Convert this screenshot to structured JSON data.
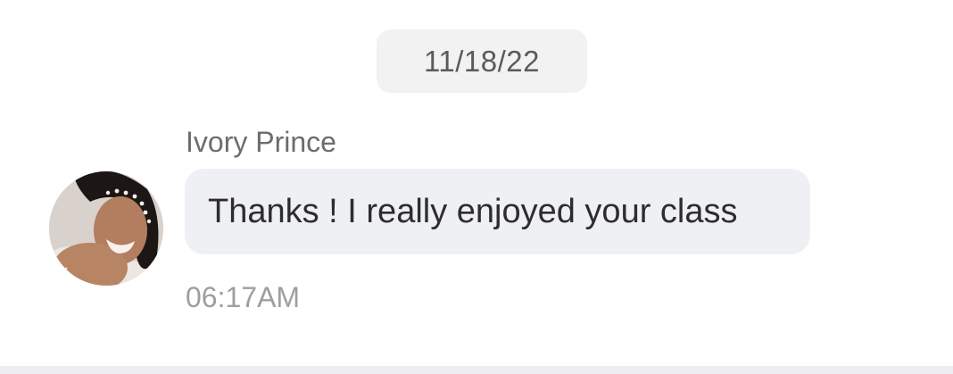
{
  "chat": {
    "date_separator": "11/18/22",
    "message": {
      "sender_name": "Ivory Prince",
      "avatar": "user-photo",
      "text": "Thanks ! I really enjoyed your class",
      "time": "06:17AM"
    }
  },
  "colors": {
    "background": "#ffffff",
    "date_chip_bg": "#f2f2f3",
    "bubble_bg": "#eff0f4",
    "sender_text": "#6c6c70",
    "message_text": "#2d2d30",
    "timestamp_text": "#9e9ea2"
  }
}
